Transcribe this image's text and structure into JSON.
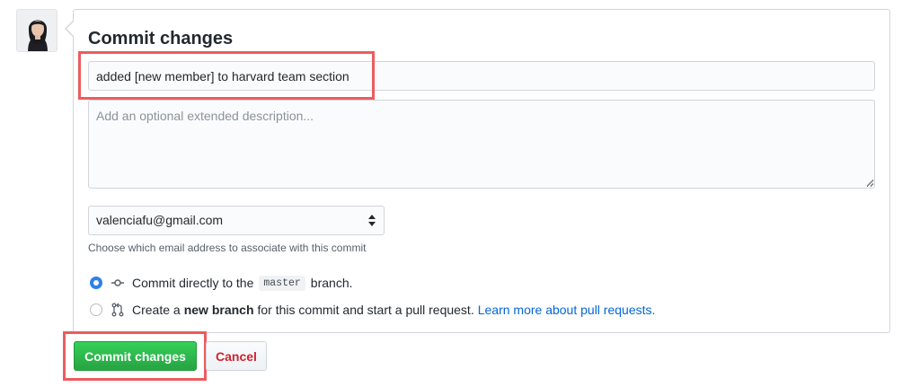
{
  "commit_form": {
    "title": "Commit changes",
    "summary_value": "added [new member] to harvard team section",
    "description_placeholder": "Add an optional extended description...",
    "email_selected": "valenciafu@gmail.com",
    "email_hint": "Choose which email address to associate with this commit",
    "options": {
      "direct": {
        "prefix": "Commit directly to the",
        "branch": "master",
        "suffix": "branch.",
        "selected": true
      },
      "new_branch": {
        "prefix": "Create a",
        "bold": "new branch",
        "suffix": "for this commit and start a pull request.",
        "link": "Learn more about pull requests.",
        "selected": false
      }
    },
    "buttons": {
      "commit_label": "Commit changes",
      "cancel_label": "Cancel"
    }
  },
  "colors": {
    "highlight": "#ed5c5e",
    "primary_button": "#28a745",
    "cancel_text": "#cb2431",
    "link": "#0366d6",
    "radio_selected": "#2f80ed"
  },
  "icons": {
    "avatar": "user-avatar",
    "commit": "git-commit-icon",
    "pull_request": "git-pull-request-icon",
    "select": "select-arrows-icon"
  }
}
